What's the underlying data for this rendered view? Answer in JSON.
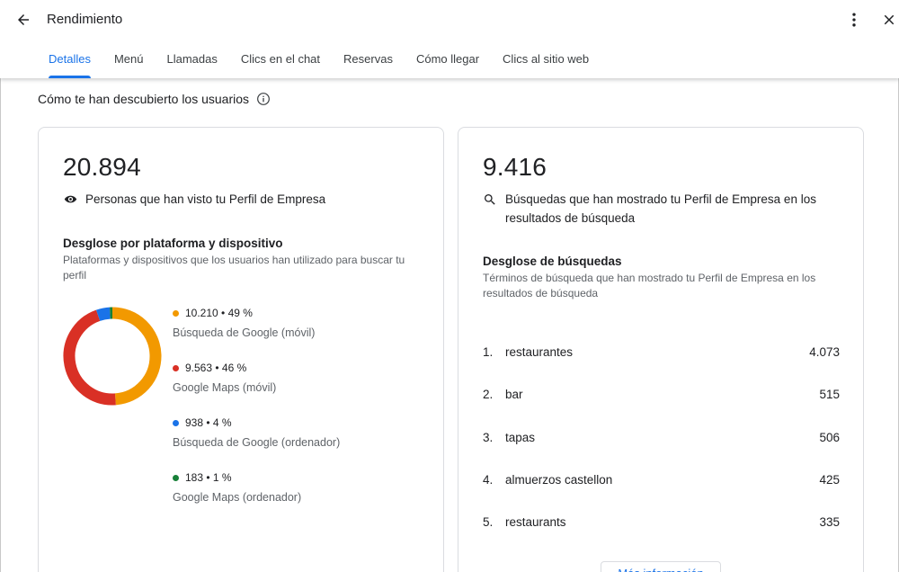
{
  "header": {
    "title": "Rendimiento",
    "back_icon": "arrow-back-icon",
    "more_icon": "more-vert-icon",
    "close_icon": "close-icon"
  },
  "tabs": [
    {
      "label": "Detalles",
      "active": true
    },
    {
      "label": "Menú",
      "active": false
    },
    {
      "label": "Llamadas",
      "active": false
    },
    {
      "label": "Clics en el chat",
      "active": false
    },
    {
      "label": "Reservas",
      "active": false
    },
    {
      "label": "Cómo llegar",
      "active": false
    },
    {
      "label": "Clics al sitio web",
      "active": false
    }
  ],
  "section": {
    "title": "Cómo te han descubierto los usuarios",
    "info_icon": "info-icon"
  },
  "views_card": {
    "total": "20.894",
    "label": "Personas que han visto tu Perfil de Empresa",
    "label_icon": "eye-icon",
    "breakdown_title": "Desglose por plataforma y dispositivo",
    "breakdown_desc": "Plataformas y dispositivos que los usuarios han utilizado para buscar tu perfil",
    "platforms": [
      {
        "value": "10.210",
        "percent": "49 %",
        "name": "Búsqueda de Google (móvil)",
        "count": 10210,
        "color": "#f29900"
      },
      {
        "value": "9.563",
        "percent": "46 %",
        "name": "Google Maps (móvil)",
        "count": 9563,
        "color": "#d93025"
      },
      {
        "value": "938",
        "percent": "4 %",
        "name": "Búsqueda de Google (ordenador)",
        "count": 938,
        "color": "#1a73e8"
      },
      {
        "value": "183",
        "percent": "1 %",
        "name": "Google Maps (ordenador)",
        "count": 183,
        "color": "#188038"
      }
    ]
  },
  "searches_card": {
    "total": "9.416",
    "label": "Búsquedas que han mostrado tu Perfil de Empresa en los resultados de búsqueda",
    "label_icon": "search-icon",
    "breakdown_title": "Desglose de búsquedas",
    "breakdown_desc": "Términos de búsqueda que han mostrado tu Perfil de Empresa en los resultados de búsqueda",
    "terms": [
      {
        "rank": "1.",
        "term": "restaurantes",
        "count": "4.073"
      },
      {
        "rank": "2.",
        "term": "bar",
        "count": "515"
      },
      {
        "rank": "3.",
        "term": "tapas",
        "count": "506"
      },
      {
        "rank": "4.",
        "term": "almuerzos castellon",
        "count": "425"
      },
      {
        "rank": "5.",
        "term": "restaurants",
        "count": "335"
      }
    ],
    "more_button": "Más información"
  }
}
